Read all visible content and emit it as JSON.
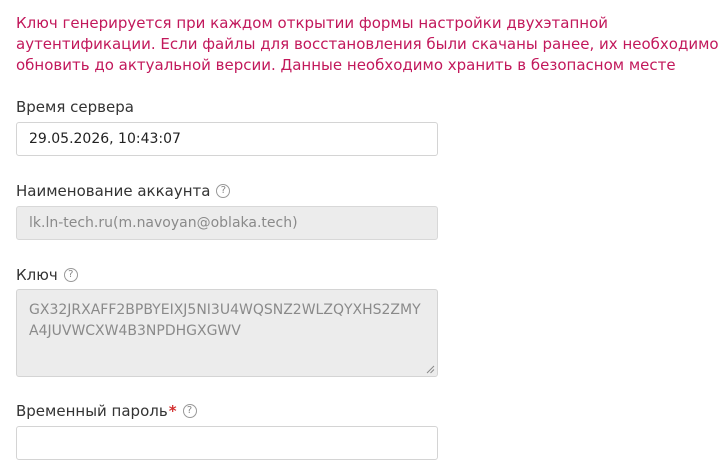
{
  "notice": {
    "line1": "Ключ генерируется при каждом открытии формы настройки двухэтапной",
    "line2": "аутентификации. Если файлы для восстановления были скачаны ранее, их необходимо",
    "line3": "обновить до актуальной версии. Данные необходимо хранить в безопасном месте"
  },
  "server_time": {
    "label": "Время сервера",
    "value": "29.05.2026, 10:43:07"
  },
  "account_name": {
    "label": "Наименование аккаунта",
    "help": "?",
    "value": "lk.ln-tech.ru(m.navoyan@oblaka.tech)"
  },
  "key": {
    "label": "Ключ",
    "help": "?",
    "line1": "GX32JRXAFF2BPBYEIXJ5NI3U4WQSNZ2WLZQYXHS2ZMY",
    "line2": "A4JUVWCXW4B3NPDHGXGWV"
  },
  "temp_password": {
    "label": "Временный пароль",
    "required_mark": "*",
    "help": "?",
    "value": ""
  },
  "colors": {
    "notice": "#c2185b",
    "required": "#d32f2f",
    "disabled_bg": "#ececec"
  }
}
